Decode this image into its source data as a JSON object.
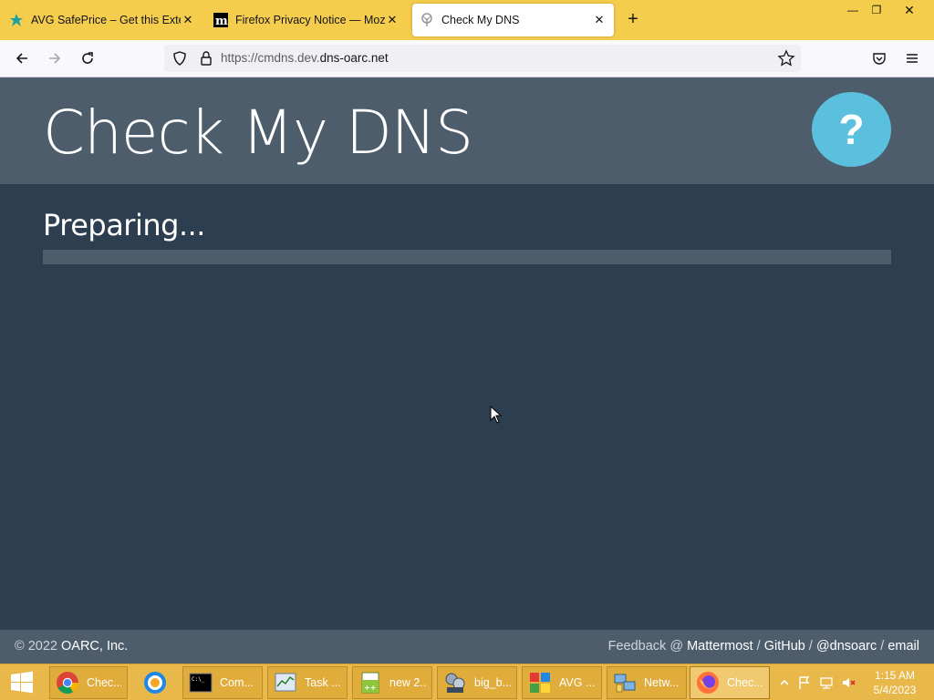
{
  "browser": {
    "tabs": [
      {
        "title": "AVG SafePrice – Get this Extension",
        "active": false,
        "favicon": "avg-icon"
      },
      {
        "title": "Firefox Privacy Notice — Mozilla",
        "active": false,
        "favicon": "mozilla-m-icon"
      },
      {
        "title": "Check My DNS",
        "active": true,
        "favicon": "tree-icon"
      }
    ],
    "new_tab": "+",
    "url_prefix": "https://cmdns.dev.",
    "url_domain": "dns-oarc.net"
  },
  "page": {
    "title": "Check My DNS",
    "help_label": "?",
    "status": "Preparing...",
    "progress": 0
  },
  "footer": {
    "copyright": "© 2022",
    "org": "OARC, Inc.",
    "feedback": "Feedback @",
    "links": [
      "Mattermost",
      "GitHub",
      "@dnsoarc",
      "email"
    ],
    "sep": "/"
  },
  "taskbar": {
    "items": [
      {
        "label": "Chec...",
        "icon": "chrome-icon",
        "pinned": false,
        "active": false
      },
      {
        "label": "",
        "icon": "avg-browser-icon",
        "pinned": true,
        "active": false
      },
      {
        "label": "Com...",
        "icon": "cmd-icon",
        "pinned": false,
        "active": false
      },
      {
        "label": "Task ...",
        "icon": "task-manager-icon",
        "pinned": false,
        "active": false
      },
      {
        "label": "new 2...",
        "icon": "notepadpp-icon",
        "pinned": false,
        "active": false
      },
      {
        "label": "big_b...",
        "icon": "film-icon",
        "pinned": false,
        "active": false
      },
      {
        "label": "AVG ...",
        "icon": "avg-icon",
        "pinned": false,
        "active": false
      },
      {
        "label": "Netw...",
        "icon": "network-icon",
        "pinned": false,
        "active": false
      },
      {
        "label": "Chec...",
        "icon": "firefox-icon",
        "pinned": false,
        "active": true
      }
    ],
    "time": "1:15 AM",
    "date": "5/4/2023"
  },
  "colors": {
    "tabstrip": "#f5cd4d",
    "header": "#4e5d6c",
    "background": "#2c3e50",
    "accent": "#5bc0de"
  }
}
